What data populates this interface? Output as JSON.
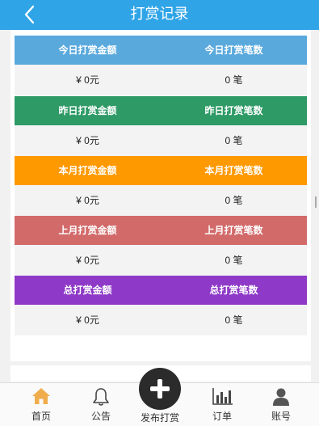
{
  "header": {
    "title": "打赏记录",
    "back_icon": "chevron-left-icon"
  },
  "colors": {
    "header": "#2fa4e7",
    "today": "#5aa9dd",
    "yesterday": "#2e9a66",
    "month": "#ff9900",
    "last_month": "#d26a6a",
    "total": "#8e39c7"
  },
  "sections": [
    {
      "amount_label": "今日打赏金额",
      "count_label": "今日打赏笔数",
      "amount": "¥ 0元",
      "count": "0 笔"
    },
    {
      "amount_label": "昨日打赏金额",
      "count_label": "昨日打赏笔数",
      "amount": "¥ 0元",
      "count": "0 笔"
    },
    {
      "amount_label": "本月打赏金额",
      "count_label": "本月打赏笔数",
      "amount": "¥ 0元",
      "count": "0 笔"
    },
    {
      "amount_label": "上月打赏金额",
      "count_label": "上月打赏笔数",
      "amount": "¥ 0元",
      "count": "0 笔"
    },
    {
      "amount_label": "总打赏金额",
      "count_label": "总打赏笔数",
      "amount": "¥ 0元",
      "count": "0 笔"
    }
  ],
  "tabbar": {
    "home": {
      "label": "首页",
      "icon": "home-icon",
      "color": "#f0ad4e"
    },
    "notice": {
      "label": "公告",
      "icon": "bell-icon"
    },
    "publish": {
      "label": "发布打赏",
      "icon": "plus-icon"
    },
    "orders": {
      "label": "订单",
      "icon": "bar-chart-icon"
    },
    "account": {
      "label": "账号",
      "icon": "user-icon"
    }
  }
}
